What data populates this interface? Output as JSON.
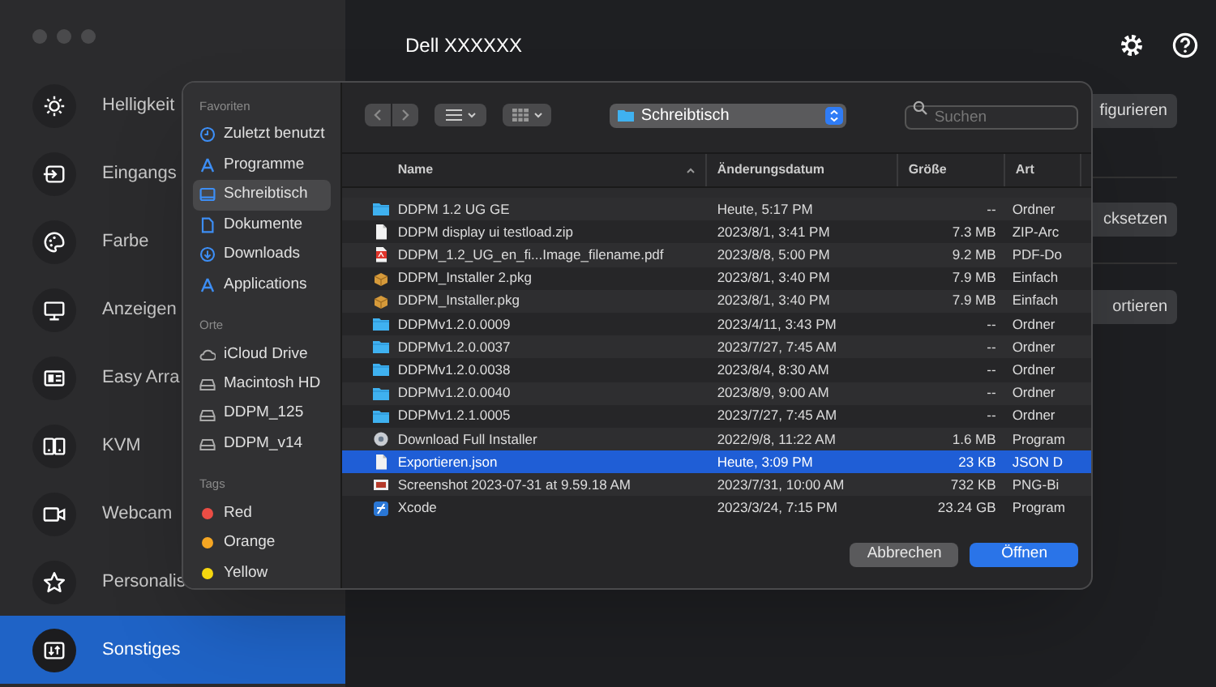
{
  "window": {
    "title": "Dell XXXXXX"
  },
  "sidebar": {
    "items": [
      {
        "label": "Helligkeit",
        "selected": false
      },
      {
        "label": "Eingangs",
        "selected": false
      },
      {
        "label": "Farbe",
        "selected": false
      },
      {
        "label": "Anzeigen",
        "selected": false
      },
      {
        "label": "Easy Arra",
        "selected": false
      },
      {
        "label": "KVM",
        "selected": false
      },
      {
        "label": "Webcam",
        "selected": false
      },
      {
        "label": "Personalis",
        "selected": false
      },
      {
        "label": "Sonstiges",
        "selected": true
      }
    ]
  },
  "content": {
    "buttons": [
      "figurieren",
      "cksetzen",
      "ortieren"
    ]
  },
  "dialog": {
    "sidebar": [
      {
        "heading": "Favoriten",
        "items": [
          {
            "label": "Zuletzt benutzt",
            "kind": "clock",
            "selected": false
          },
          {
            "label": "Programme",
            "kind": "apps",
            "selected": false
          },
          {
            "label": "Schreibtisch",
            "kind": "desktop",
            "selected": true
          },
          {
            "label": "Dokumente",
            "kind": "doc",
            "selected": false
          },
          {
            "label": "Downloads",
            "kind": "download",
            "selected": false
          },
          {
            "label": "Applications",
            "kind": "apps",
            "selected": false
          }
        ]
      },
      {
        "heading": "Orte",
        "items": [
          {
            "label": "iCloud Drive",
            "kind": "cloud",
            "selected": false
          },
          {
            "label": "Macintosh HD",
            "kind": "disk",
            "selected": false
          },
          {
            "label": "DDPM_125",
            "kind": "disk",
            "selected": false
          },
          {
            "label": "DDPM_v14",
            "kind": "disk",
            "selected": false
          }
        ]
      },
      {
        "heading": "Tags",
        "items": [
          {
            "label": "Red",
            "kind": "tag",
            "color": "#eb4d45",
            "selected": false
          },
          {
            "label": "Orange",
            "kind": "tag",
            "color": "#f5a623",
            "selected": false
          },
          {
            "label": "Yellow",
            "kind": "tag",
            "color": "#f6d70f",
            "selected": false
          }
        ]
      }
    ],
    "location": "Schreibtisch",
    "search": {
      "placeholder": "Suchen"
    },
    "columns": [
      "Name",
      "Änderungsdatum",
      "Größe",
      "Art"
    ],
    "files": [
      {
        "name": "DDPM 1.2 UG GE",
        "date": "Heute, 5:17 PM",
        "size": "--",
        "type": "Ordner",
        "kind": "folder",
        "selected": false
      },
      {
        "name": "DDPM display ui testload.zip",
        "date": "2023/8/1, 3:41 PM",
        "size": "7.3 MB",
        "type": "ZIP-Arc",
        "kind": "doc",
        "selected": false
      },
      {
        "name": "DDPM_1.2_UG_en_fi...Image_filename.pdf",
        "date": "2023/8/8, 5:00 PM",
        "size": "9.2 MB",
        "type": "PDF-Do",
        "kind": "pdf",
        "selected": false
      },
      {
        "name": "DDPM_Installer 2.pkg",
        "date": "2023/8/1, 3:40 PM",
        "size": "7.9 MB",
        "type": "Einfach",
        "kind": "pkg",
        "selected": false
      },
      {
        "name": "DDPM_Installer.pkg",
        "date": "2023/8/1, 3:40 PM",
        "size": "7.9 MB",
        "type": "Einfach",
        "kind": "pkg",
        "selected": false
      },
      {
        "name": "DDPMv1.2.0.0009",
        "date": "2023/4/11, 3:43 PM",
        "size": "--",
        "type": "Ordner",
        "kind": "folder",
        "selected": false
      },
      {
        "name": "DDPMv1.2.0.0037",
        "date": "2023/7/27, 7:45 AM",
        "size": "--",
        "type": "Ordner",
        "kind": "folder",
        "selected": false
      },
      {
        "name": "DDPMv1.2.0.0038",
        "date": "2023/8/4, 8:30 AM",
        "size": "--",
        "type": "Ordner",
        "kind": "folder",
        "selected": false
      },
      {
        "name": "DDPMv1.2.0.0040",
        "date": "2023/8/9, 9:00 AM",
        "size": "--",
        "type": "Ordner",
        "kind": "folder",
        "selected": false
      },
      {
        "name": "DDPMv1.2.1.0005",
        "date": "2023/7/27, 7:45 AM",
        "size": "--",
        "type": "Ordner",
        "kind": "folder",
        "selected": false
      },
      {
        "name": "Download Full Installer",
        "date": "2022/9/8, 11:22 AM",
        "size": "1.6 MB",
        "type": "Program",
        "kind": "installer",
        "selected": false
      },
      {
        "name": "Exportieren.json",
        "date": "Heute, 3:09 PM",
        "size": "23 KB",
        "type": "JSON D",
        "kind": "doc",
        "selected": true
      },
      {
        "name": "Screenshot 2023-07-31 at 9.59.18 AM",
        "date": "2023/7/31, 10:00 AM",
        "size": "732 KB",
        "type": "PNG-Bi",
        "kind": "image",
        "selected": false
      },
      {
        "name": "Xcode",
        "date": "2023/3/24, 7:15 PM",
        "size": "23.24 GB",
        "type": "Program",
        "kind": "app",
        "selected": false
      }
    ],
    "buttons": [
      {
        "label": "Abbrechen",
        "kind": "secondary"
      },
      {
        "label": "Öffnen",
        "kind": "primary"
      }
    ]
  }
}
